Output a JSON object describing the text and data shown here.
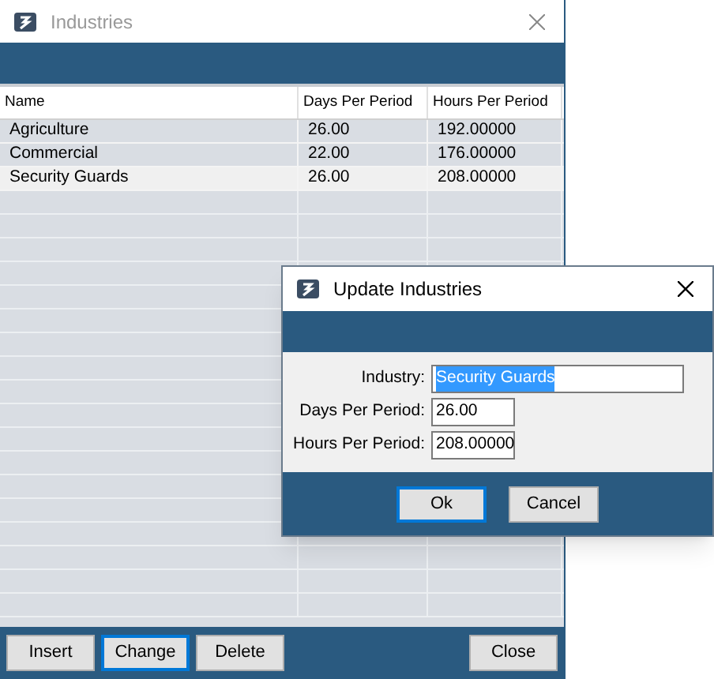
{
  "window": {
    "title": "Industries",
    "active": false
  },
  "table": {
    "columns": [
      "Name",
      "Days Per Period",
      "Hours Per Period"
    ],
    "rows": [
      {
        "cells": [
          "Agriculture",
          "26.00",
          "192.00000"
        ],
        "selected": false
      },
      {
        "cells": [
          "Commercial",
          "22.00",
          "176.00000"
        ],
        "selected": false
      },
      {
        "cells": [
          "Security Guards",
          "26.00",
          "208.00000"
        ],
        "selected": true
      }
    ]
  },
  "buttons": [
    {
      "label": "Insert",
      "focused": false
    },
    {
      "label": "Change",
      "focused": true
    },
    {
      "label": "Delete",
      "focused": false
    },
    {
      "label": "Close",
      "focused": false
    }
  ],
  "dialog": {
    "title": "Update Industries",
    "active": true,
    "fields": [
      {
        "label": "Industry:",
        "value": "Security Guards",
        "highlighted": true
      },
      {
        "label": "Days Per Period:",
        "value": "26.00",
        "highlighted": false
      },
      {
        "label": "Hours Per Period:",
        "value": "208.00000",
        "highlighted": false
      }
    ],
    "buttons": [
      {
        "label": "Ok",
        "focused": true
      },
      {
        "label": "Cancel",
        "focused": false
      }
    ]
  }
}
